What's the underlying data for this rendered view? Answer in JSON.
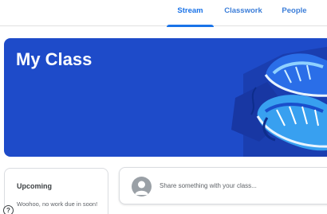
{
  "tabs": [
    {
      "label": "Stream",
      "active": true
    },
    {
      "label": "Classwork",
      "active": false
    },
    {
      "label": "People",
      "active": false
    }
  ],
  "banner": {
    "title": "My Class",
    "color": "#1e4bc9"
  },
  "upcoming": {
    "title": "Upcoming",
    "text": "Woohoo, no work due in soon!"
  },
  "share": {
    "placeholder": "Share something with your class..."
  },
  "help": {
    "icon": "help-icon",
    "glyph": "?"
  },
  "colors": {
    "accent": "#1a73e8",
    "banner": "#1e4bc9"
  }
}
